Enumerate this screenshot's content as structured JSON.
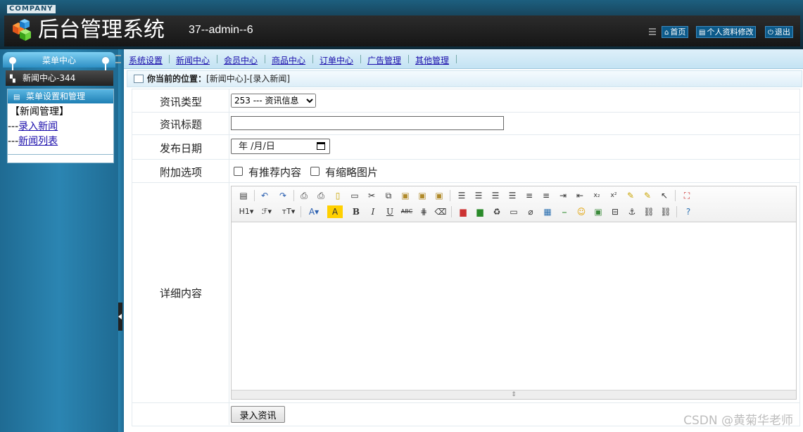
{
  "header": {
    "company": "COMPANY",
    "title": "后台管理系统",
    "user_label": "37--admin--6",
    "buttons": [
      {
        "icon": "home-icon",
        "label": "首页"
      },
      {
        "icon": "profile-icon",
        "label": "个人资料修改"
      },
      {
        "icon": "power-icon",
        "label": "退出"
      }
    ]
  },
  "sidebar": {
    "menu_title": "菜单中心",
    "current_module": "新闻中心-344",
    "panel_title": "菜单设置和管理",
    "group": "【新闻管理】",
    "links": [
      {
        "prefix": "---",
        "label": "录入新闻"
      },
      {
        "prefix": "---",
        "label": "新闻列表"
      }
    ]
  },
  "topnav": [
    "系统设置",
    "新闻中心",
    "会员中心",
    "商品中心",
    "订单中心",
    "广告管理",
    "其他管理"
  ],
  "breadcrumb": {
    "label": "你当前的位置：",
    "path": "[新闻中心]-[录入新闻]"
  },
  "form": {
    "type_label": "资讯类型",
    "type_value": "253 --- 资讯信息",
    "title_label": "资讯标题",
    "title_value": "",
    "date_label": "发布日期",
    "date_value": "年 /月/日",
    "options_label": "附加选项",
    "option1": "有推荐内容",
    "option2": "有缩略图片",
    "content_label": "详细内容",
    "submit_label": "录入资讯"
  },
  "watermark": "CSDN @黄菊华老师"
}
